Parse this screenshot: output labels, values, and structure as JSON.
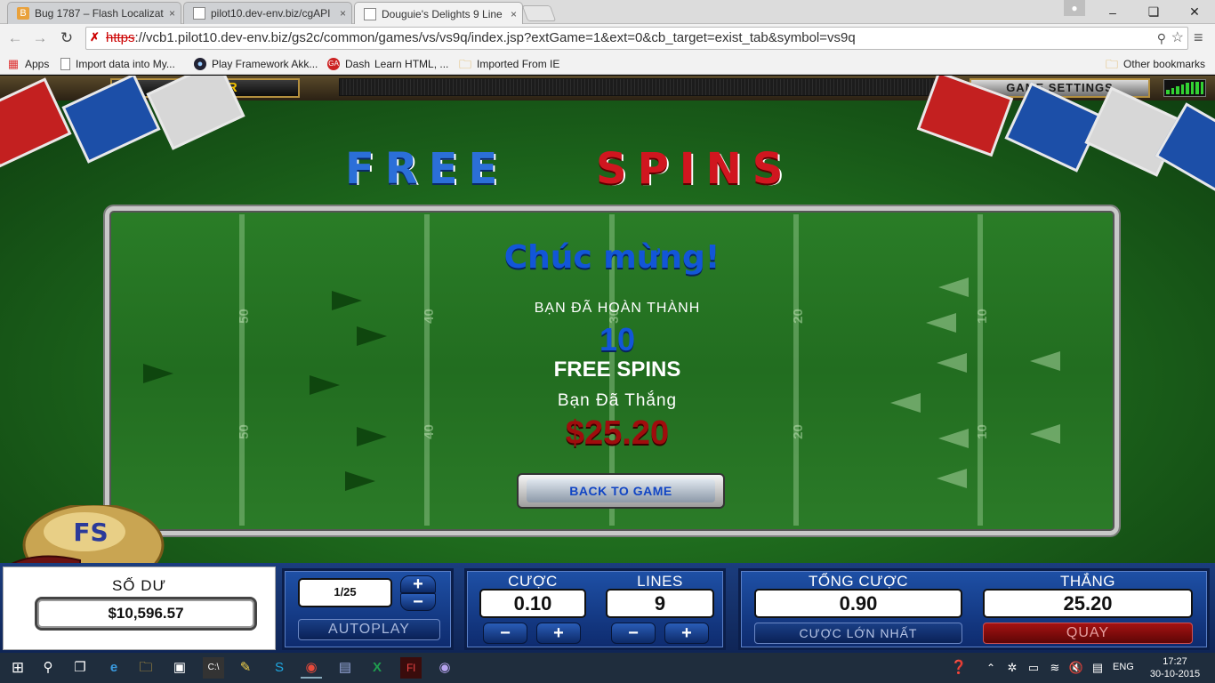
{
  "browser": {
    "tabs": [
      {
        "title": "Bug 1787 – Flash Localizat",
        "icon": "bug-icon",
        "close": "×"
      },
      {
        "title": "pilot10.dev-env.biz/cgAPI",
        "icon": "page-icon",
        "close": "×"
      },
      {
        "title": "Douguie's Delights 9 Line",
        "icon": "page-icon",
        "close": "×",
        "active": true
      }
    ],
    "url_scheme": "https",
    "url_rest": "://vcb1.pilot10.dev-env.biz/gs2c/common/games/vs/vs9q/index.jsp?extGame=1&ext=0&cb_target=exist_tab&symbol=vs9q",
    "bookmarks": [
      {
        "label": "Apps",
        "icon": "apps-grid-icon"
      },
      {
        "label": "Import data into My...",
        "icon": "page-icon"
      },
      {
        "label": "Play Framework Akk...",
        "icon": "play-framework-icon"
      },
      {
        "label": "Dash",
        "icon": "dash-icon"
      },
      {
        "label": "Learn HTML, ...",
        "icon": ""
      },
      {
        "label": "Imported From IE",
        "icon": "folder-icon"
      }
    ],
    "other_bookmarks": "Other bookmarks"
  },
  "game": {
    "cashier_label": "CASHIER",
    "settings_label": "GAME SETTINGS",
    "banner_free": "FREE",
    "banner_spins": "SPINS",
    "dialog": {
      "congrats": "Chúc mừng!",
      "completed": "BẠN ĐÃ HOÀN THÀNH",
      "spin_count": "10",
      "free_spins": "FREE SPINS",
      "won_label": "Bạn Đã Thắng",
      "win_amount": "$25.20",
      "back_button": "BACK TO GAME"
    },
    "field_numbers": [
      "50",
      "40",
      "30",
      "20",
      "10"
    ],
    "helmet_text": "FS",
    "stars": "★ ★ ★ ★ ★ ★ ★ ★ ★ ★ ★ ★ ★ ★ ★"
  },
  "controls": {
    "balance_label": "SỐ DƯ",
    "balance_value": "$10,596.57",
    "autoplay_count": "1/25",
    "autoplay_label": "AUTOPLAY",
    "bet_label": "CƯỢC",
    "bet_value": "0.10",
    "lines_label": "LINES",
    "lines_value": "9",
    "total_bet_label": "TỔNG CƯỢC",
    "total_bet_value": "0.90",
    "max_bet_label": "CƯỢC LỚN NHẤT",
    "win_label": "THẮNG",
    "win_value": "25.20",
    "spin_label": "QUAY",
    "minus": "−",
    "plus": "+"
  },
  "taskbar": {
    "time": "17:27",
    "date": "30-10-2015",
    "language": "ENG"
  },
  "colors": {
    "accent_blue": "#1256d8",
    "win_red": "#a00d0d",
    "field_green": "#226d20",
    "panel_blue": "#1e50a6"
  }
}
